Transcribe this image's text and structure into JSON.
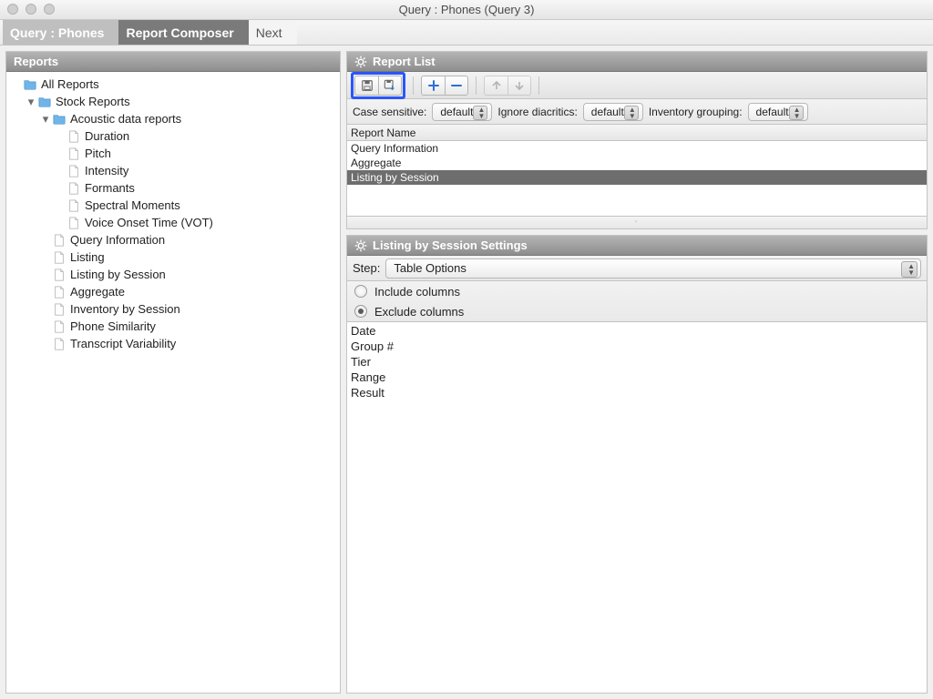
{
  "window": {
    "title": "Query : Phones (Query 3)"
  },
  "breadcrumbs": {
    "c1": "Query : Phones",
    "c2": "Report Composer",
    "c3": "Next"
  },
  "left": {
    "header": "Reports",
    "tree": {
      "all_reports": "All Reports",
      "stock_reports": "Stock Reports",
      "acoustic": "Acoustic data reports",
      "acoustic_children": [
        "Duration",
        "Pitch",
        "Intensity",
        "Formants",
        "Spectral Moments",
        "Voice Onset Time (VOT)"
      ],
      "stock_children": [
        "Query Information",
        "Listing",
        "Listing by Session",
        "Aggregate",
        "Inventory by Session",
        "Phone Similarity",
        "Transcript Variability"
      ]
    }
  },
  "report_list": {
    "header": "Report List",
    "options": {
      "case_label": "Case sensitive:",
      "case_value": "default",
      "diacritics_label": "Ignore diacritics:",
      "diacritics_value": "default",
      "grouping_label": "Inventory grouping:",
      "grouping_value": "default"
    },
    "table_header": "Report Name",
    "rows": [
      "Query Information",
      "Aggregate",
      "Listing by Session"
    ],
    "selected_index": 2
  },
  "settings": {
    "header": "Listing by Session Settings",
    "step_label": "Step:",
    "step_value": "Table Options",
    "radios": {
      "include": "Include columns",
      "exclude": "Exclude columns",
      "selected": "exclude"
    },
    "columns": [
      "Date",
      "Group #",
      "Tier",
      "Range",
      "Result"
    ]
  },
  "icons": {
    "save": "save-icon",
    "save_arrow": "save-arrow-icon",
    "plus": "plus-icon",
    "minus": "minus-icon",
    "up": "arrow-up-icon",
    "down": "arrow-down-icon"
  }
}
